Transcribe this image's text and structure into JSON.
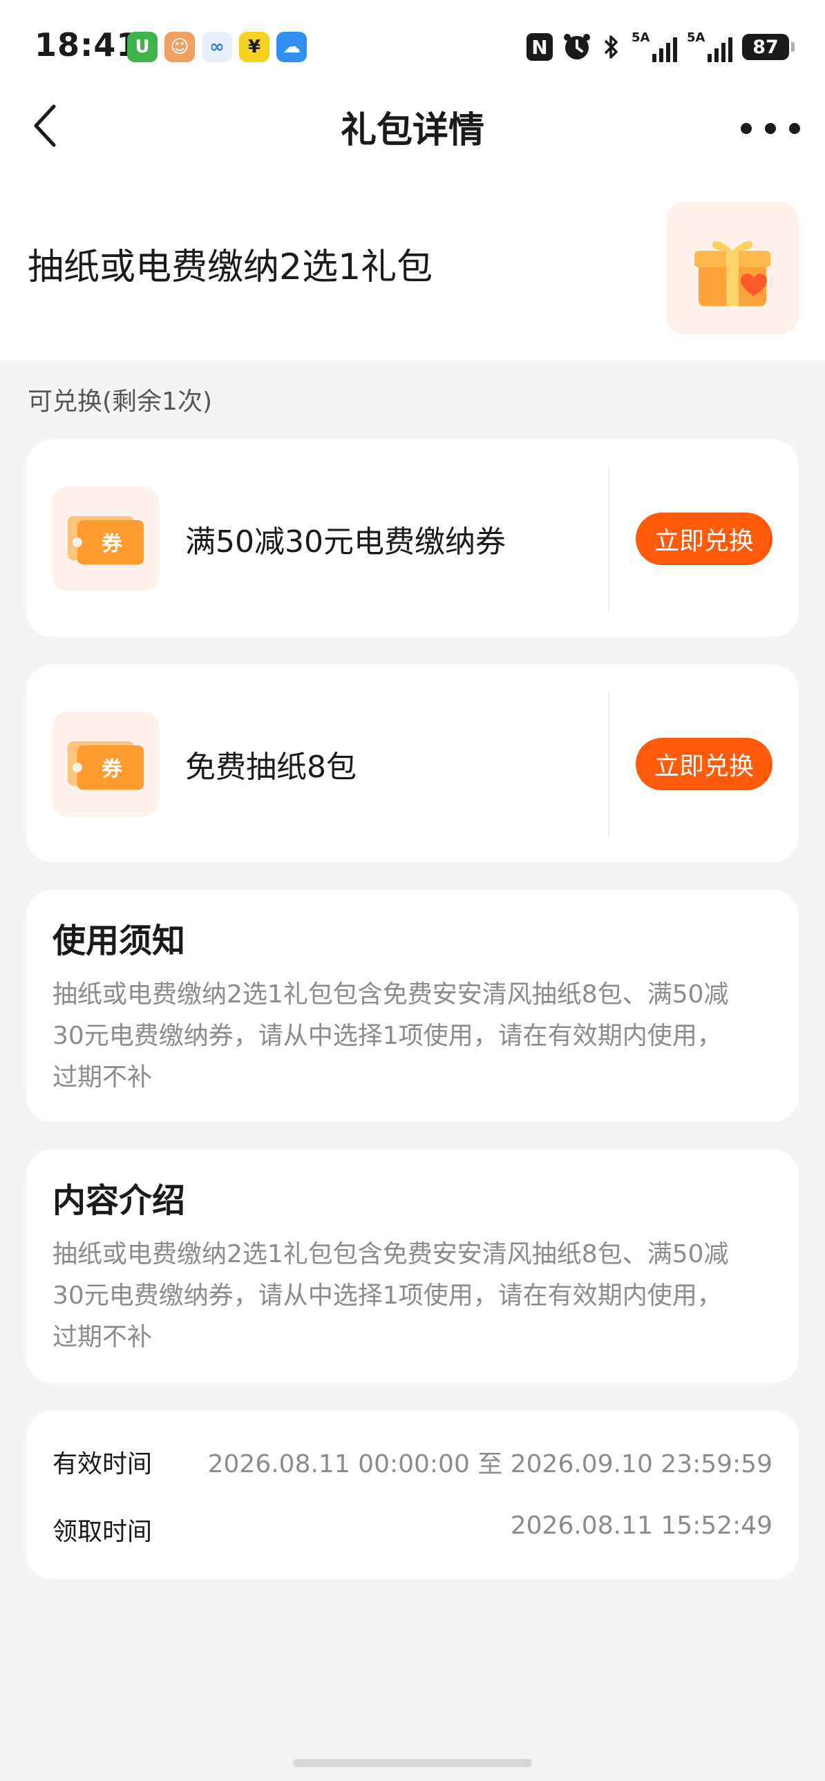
{
  "status_bar": {
    "time": "18:41",
    "app_icons": [
      {
        "name": "green-app-icon",
        "glyph": "U",
        "color": "#3db34a"
      },
      {
        "name": "mascot-app-icon",
        "glyph": "☺",
        "color": "#f0a060"
      },
      {
        "name": "blue-swirl-app-icon",
        "glyph": "∞",
        "color": "#e8f0fb"
      },
      {
        "name": "yuan-app-icon",
        "glyph": "¥",
        "color": "#f6d31f"
      },
      {
        "name": "weather-app-icon",
        "glyph": "☁",
        "color": "#2f8ff0"
      }
    ],
    "nfc": "N",
    "signal_1_label": "5A",
    "signal_2_label": "5A",
    "battery": "87"
  },
  "nav": {
    "title": "礼包详情"
  },
  "gift": {
    "name": "抽纸或电费缴纳2选1礼包"
  },
  "redeem": {
    "heading": "可兑换(剩余1次)",
    "coupons": [
      {
        "icon_text": "券",
        "title": "满50减30元电费缴纳券",
        "button": "立即兑换"
      },
      {
        "icon_text": "券",
        "title": "免费抽纸8包",
        "button": "立即兑换"
      }
    ]
  },
  "usage": {
    "title": "使用须知",
    "lines": [
      "抽纸或电费缴纳2选1礼包包含免费安安清风抽纸8包、满50减",
      "30元电费缴纳券，请从中选择1项使用，请在有效期内使用，",
      "过期不补"
    ]
  },
  "content": {
    "title": "内容介绍",
    "lines": [
      "抽纸或电费缴纳2选1礼包包含免费安安清风抽纸8包、满50减",
      "30元电费缴纳券，请从中选择1项使用，请在有效期内使用，",
      "过期不补"
    ]
  },
  "times": {
    "valid_label": "有效时间",
    "valid_value": "2026.08.11 00:00:00 至 2026.09.10 23:59:59",
    "claim_label": "领取时间",
    "claim_value": "2026.08.11 15:52:49"
  },
  "colors": {
    "accent": "#ff5a0a",
    "background": "#f4f4f6",
    "card": "#ffffff",
    "muted_text": "#8c8c8c"
  }
}
